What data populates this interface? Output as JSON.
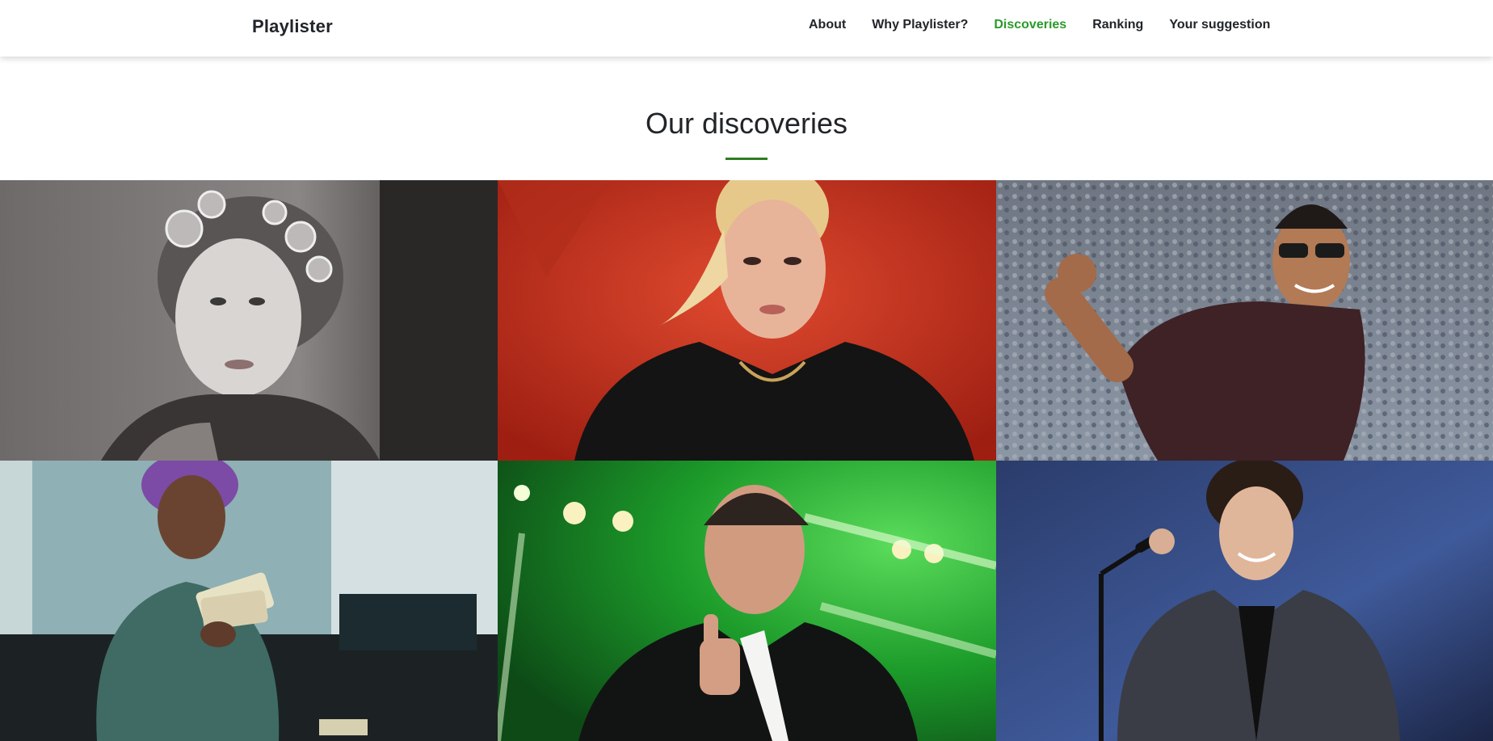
{
  "navbar": {
    "brand": "Playlister",
    "links": [
      {
        "label": "About",
        "active": false
      },
      {
        "label": "Why Playlister?",
        "active": false
      },
      {
        "label": "Discoveries",
        "active": true
      },
      {
        "label": "Ranking",
        "active": false
      },
      {
        "label": "Your suggestion",
        "active": false
      }
    ]
  },
  "section": {
    "title": "Our discoveries"
  },
  "colors": {
    "accent": "#2b9a2b",
    "divider": "#2e7d1f"
  },
  "gallery": {
    "items": [
      {
        "subject": "woman-hair-rollers-bw",
        "bg": "#5a5656"
      },
      {
        "subject": "blonde-woman-red-background",
        "bg": "#c93a25"
      },
      {
        "subject": "man-sunglasses-stadium",
        "bg": "#7b8797"
      },
      {
        "subject": "man-purple-dreads-counting-money",
        "bg": "#6f8f95"
      },
      {
        "subject": "man-thumbs-up-green-stage",
        "bg": "#1f8f2a"
      },
      {
        "subject": "curly-hair-singer-microphone",
        "bg": "#24345e"
      }
    ]
  }
}
